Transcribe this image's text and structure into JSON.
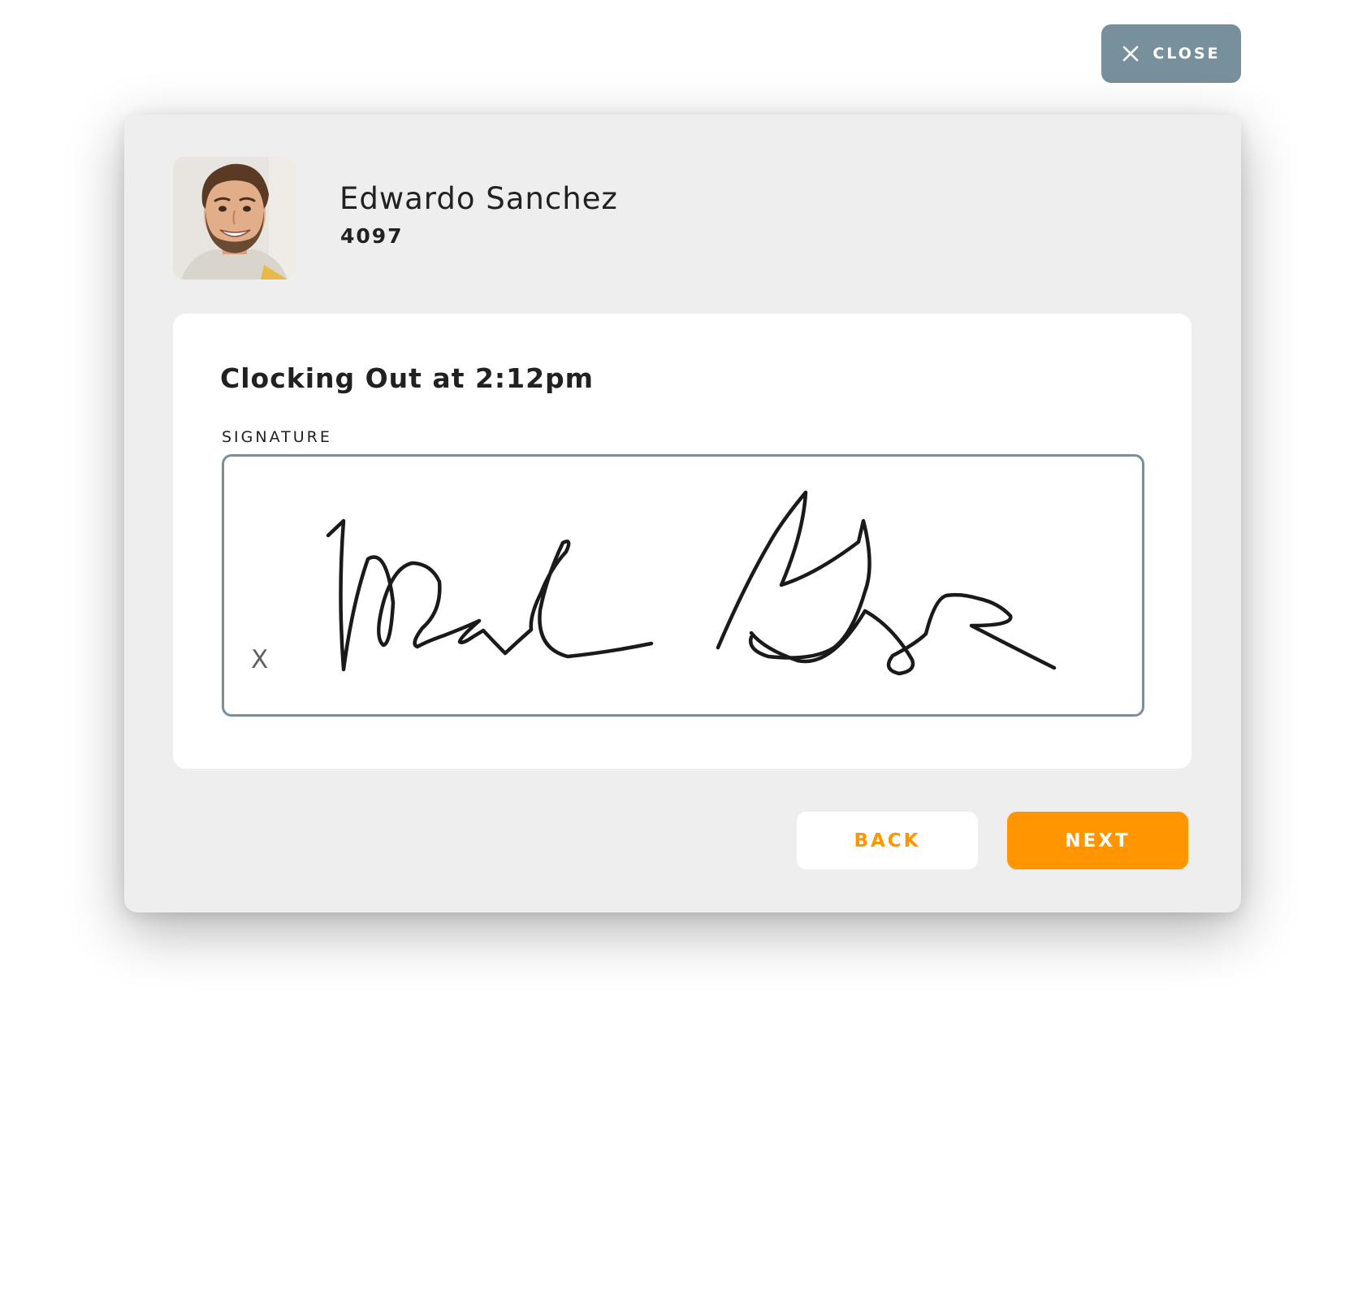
{
  "header": {
    "close_label": "CLOSE",
    "close_icon": "close-icon"
  },
  "employee": {
    "name": "Edwardo Sanchez",
    "id": "4097",
    "avatar": "avatar-photo"
  },
  "clock": {
    "title": "Clocking Out at 2:12pm",
    "signature_label": "SIGNATURE",
    "signature_marker": "X"
  },
  "actions": {
    "back_label": "BACK",
    "next_label": "NEXT"
  },
  "colors": {
    "accent": "#ff9500",
    "close_button": "#78909c",
    "modal_background": "#eeeeee",
    "signature_border": "#78909c",
    "text": "#212121"
  }
}
